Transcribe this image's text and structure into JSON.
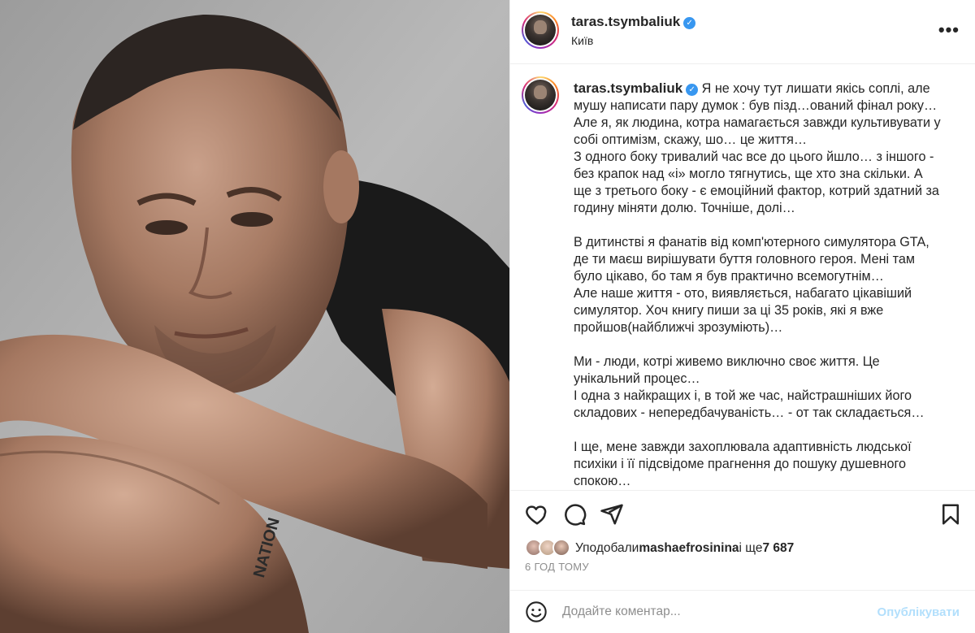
{
  "post": {
    "username": "taras.tsymbaliuk",
    "verified_icon": "verified-badge-icon",
    "location": "Київ",
    "more_icon": "more-options-icon"
  },
  "caption": {
    "username": "taras.tsymbaliuk",
    "text": " Я не хочу тут лишати якісь соплі, але мушу написати пару думок : був пізд…ований фінал року…\nАле я, як людина, котра намагається завжди культивувати у собі оптимізм, скажу, шо… це життя…\nЗ одного боку тривалий час все до цього йшло… з іншого - без крапок над «і» могло тягнутись, ще хто зна скільки. А ще з третього боку - є емоційний фактор, котрий здатний за годину міняти долю. Точніше, долі…\n\nВ дитинстві я фанатів від комп'ютерного симулятора GTA, де ти маєш вирішувати буття головного героя. Мені там було цікаво, бо там я був практично всемогутнім…\nАле наше життя - ото, виявляється, набагато цікавіший симулятор. Хоч книгу пиши за ці 35 років, які я вже пройшов(найближчі зрозуміють)…\n\nМи - люди, котрі живемо виключно своє життя. Це унікальний процес…\nІ одна з найкращих і, в той же час, найстрашніших його складових - непередбачуваність… - от так складається…\n\nІ ще, мене завжди захоплювала адаптивність людської психіки і її підсвідоме прагнення до пошуку душевного спокою…"
  },
  "actions": {
    "like_icon": "heart-icon",
    "comment_icon": "comment-icon",
    "share_icon": "share-icon",
    "save_icon": "bookmark-icon"
  },
  "likes": {
    "prefix": "Уподобали ",
    "user": "mashaefrosinina",
    "middle": " і ще ",
    "count": "7 687"
  },
  "timestamp": "6 ГОД ТОМУ",
  "comment": {
    "emoji_icon": "emoji-icon",
    "placeholder": "Додайте коментар...",
    "publish_label": "Опублікувати"
  },
  "colors": {
    "accent_link": "#b2dffc",
    "verified": "#3897f0",
    "text": "#262626",
    "secondary": "#8e8e8e"
  }
}
